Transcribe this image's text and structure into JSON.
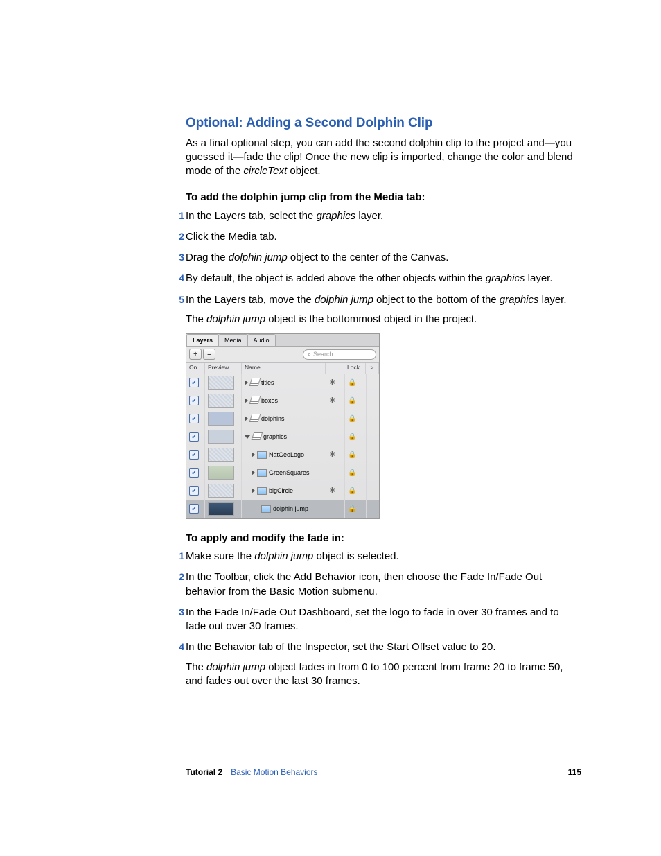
{
  "section": {
    "title": "Optional:  Adding a Second Dolphin Clip",
    "intro_pre": "As a final optional step, you can add the second dolphin clip to the project and—you guessed it—fade the clip! Once the new clip is imported, change the color and blend mode of the ",
    "intro_em": "circleText",
    "intro_post": " object."
  },
  "proc1": {
    "heading": "To add the dolphin jump clip from the Media tab:",
    "s1_a": "In the Layers tab, select the ",
    "s1_em": "graphics",
    "s1_b": " layer.",
    "s2": "Click the Media tab.",
    "s3_a": "Drag the ",
    "s3_em": "dolphin jump",
    "s3_b": " object to the center of the Canvas.",
    "s4_a": "By default, the object is added above the other objects within the ",
    "s4_em": "graphics",
    "s4_b": " layer.",
    "s5_a": "In the Layers tab, move the ",
    "s5_em": "dolphin jump",
    "s5_b": " object to the bottom of the ",
    "s5_em2": "graphics",
    "s5_c": " layer.",
    "s5_follow_a": "The ",
    "s5_follow_em": "dolphin jump",
    "s5_follow_b": " object is the bottommost object in the project."
  },
  "panel": {
    "tabs": {
      "layers": "Layers",
      "media": "Media",
      "audio": "Audio"
    },
    "plus": "+",
    "minus": "–",
    "search_placeholder": "Search",
    "cols": {
      "on": "On",
      "preview": "Preview",
      "name": "Name",
      "lock": "Lock",
      "ext": ">"
    },
    "rows": [
      {
        "name": "titles",
        "kind": "group",
        "indent": 0,
        "tri": "right",
        "gear": true,
        "thumb": "hatch"
      },
      {
        "name": "boxes",
        "kind": "group",
        "indent": 0,
        "tri": "right",
        "gear": true,
        "thumb": "hatch"
      },
      {
        "name": "dolphins",
        "kind": "group",
        "indent": 0,
        "tri": "right",
        "gear": false,
        "thumb": "blue"
      },
      {
        "name": "graphics",
        "kind": "group",
        "indent": 0,
        "tri": "down",
        "gear": false,
        "thumb": "solid"
      },
      {
        "name": "NatGeoLogo",
        "kind": "item",
        "indent": 1,
        "tri": "right",
        "gear": true,
        "thumb": "hatch"
      },
      {
        "name": "GreenSquares",
        "kind": "item",
        "indent": 1,
        "tri": "right",
        "gear": false,
        "thumb": "green"
      },
      {
        "name": "bigCircle",
        "kind": "item",
        "indent": 1,
        "tri": "right",
        "gear": true,
        "thumb": "hatch"
      },
      {
        "name": "dolphin jump",
        "kind": "clip",
        "indent": 2,
        "tri": "none",
        "gear": false,
        "thumb": "dolphin",
        "selected": true
      }
    ]
  },
  "proc2": {
    "heading": "To apply and modify the fade in:",
    "s1_a": "Make sure the ",
    "s1_em": "dolphin jump",
    "s1_b": " object is selected.",
    "s2": "In the Toolbar, click the Add Behavior icon, then choose the Fade In/Fade Out behavior from the Basic Motion submenu.",
    "s3": "In the Fade In/Fade Out Dashboard, set the logo to fade in over 30 frames and to fade out over 30 frames.",
    "s4": "In the Behavior tab of the Inspector, set the Start Offset value to 20.",
    "s4_follow_a": "The ",
    "s4_follow_em": "dolphin jump",
    "s4_follow_b": " object fades in from 0 to 100 percent from frame 20 to frame 50, and fades out over the last 30 frames."
  },
  "footer": {
    "tutorial": "Tutorial 2",
    "chapter": "Basic Motion Behaviors",
    "page": "115"
  },
  "nums": {
    "n1": "1",
    "n2": "2",
    "n3": "3",
    "n4": "4",
    "n5": "5"
  }
}
